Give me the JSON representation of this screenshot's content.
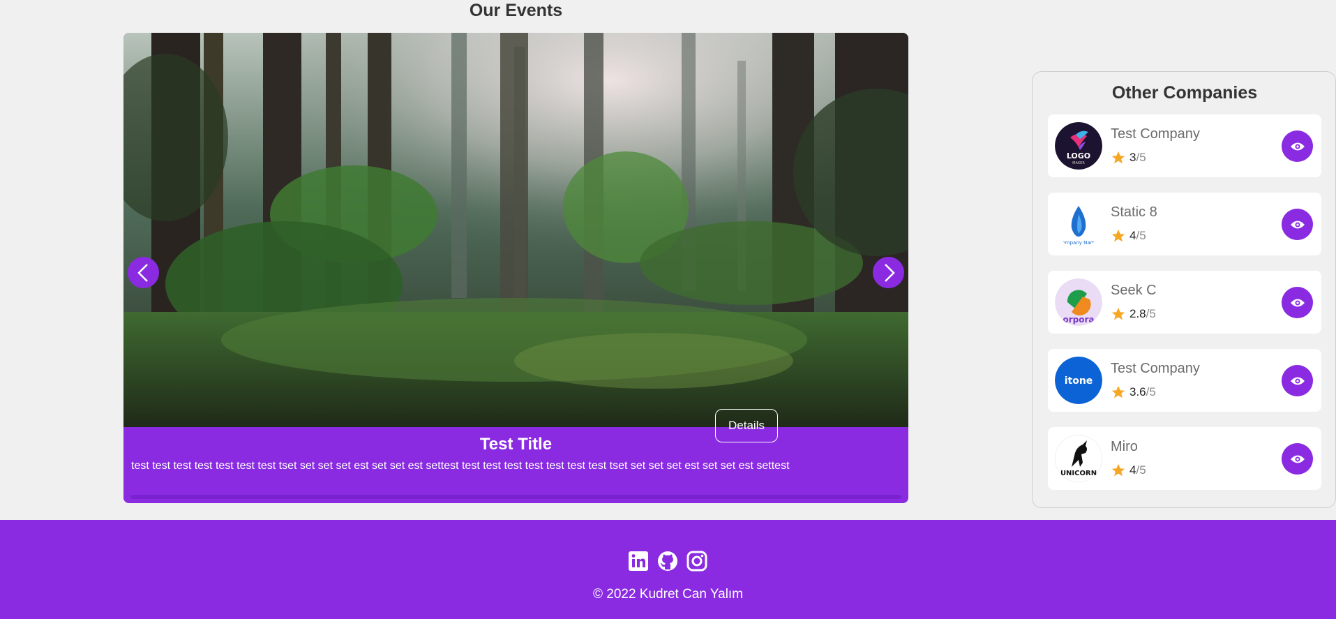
{
  "events": {
    "title": "Our Events",
    "slide": {
      "title": "Test Title",
      "description": "test test test test test test test tset set set set est set set est settest test test test test test test test tset set set set est set set est settest",
      "details_label": "Details"
    }
  },
  "companies": {
    "title": "Other Companies",
    "items": [
      {
        "name": "Test Company",
        "rating": "3",
        "max": "/5",
        "logo": "logo-maker"
      },
      {
        "name": "Static 8",
        "rating": "4",
        "max": "/5",
        "logo": "blue-drop"
      },
      {
        "name": "Seek C",
        "rating": "2.8",
        "max": "/5",
        "logo": "green-orange"
      },
      {
        "name": "Test Company",
        "rating": "3.6",
        "max": "/5",
        "logo": "itone"
      },
      {
        "name": "Miro",
        "rating": "4",
        "max": "/5",
        "logo": "unicorn"
      }
    ]
  },
  "footer": {
    "copyright": "© 2022 Kudret Can Yalım",
    "social": [
      "linkedin-icon",
      "github-icon",
      "instagram-icon"
    ]
  },
  "colors": {
    "accent": "#8a2be2",
    "star": "#f5a623",
    "background": "#f0f0f0"
  }
}
